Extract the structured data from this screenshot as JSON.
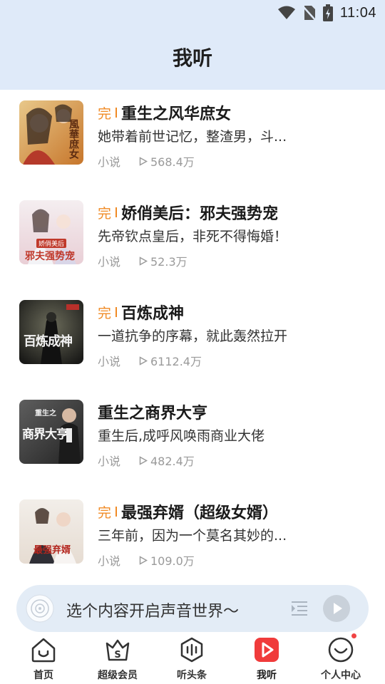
{
  "status_bar": {
    "time": "11:04"
  },
  "header": {
    "title": "我听"
  },
  "books": [
    {
      "badge": "完",
      "title": "重生之风华庶女",
      "desc": "她带着前世记忆，整渣男，斗...",
      "category": "小说",
      "plays": "568.4万"
    },
    {
      "badge": "完",
      "title": "娇俏美后：邪夫强势宠",
      "desc": "先帝钦点皇后，非死不得悔婚！",
      "category": "小说",
      "plays": "52.3万"
    },
    {
      "badge": "完",
      "title": "百炼成神",
      "desc": "一道抗争的序幕，就此轰然拉开",
      "category": "小说",
      "plays": "6112.4万"
    },
    {
      "badge": "",
      "title": "重生之商界大亨",
      "desc": "重生后,成呼风唤雨商业大佬",
      "category": "小说",
      "plays": "482.4万"
    },
    {
      "badge": "完",
      "title": "最强弃婿（超级女婿）",
      "desc": "三年前，因为一个莫名其妙的...",
      "category": "小说",
      "plays": "109.0万"
    }
  ],
  "covers": [
    {
      "text": "風華庶女"
    },
    {
      "text": "邪夫强势宠",
      "subtext": "娇俏美后"
    },
    {
      "text": "百炼成神"
    },
    {
      "text": "商界大亨",
      "subtext": "重生之"
    },
    {
      "text": "最强弃婿"
    }
  ],
  "player": {
    "prompt": "选个内容开启声音世界～"
  },
  "tabs": [
    {
      "label": "首页",
      "icon": "home-icon"
    },
    {
      "label": "超级会员",
      "icon": "vip-icon"
    },
    {
      "label": "听头条",
      "icon": "headline-icon"
    },
    {
      "label": "我听",
      "icon": "my-listen-icon"
    },
    {
      "label": "个人中心",
      "icon": "profile-icon"
    }
  ],
  "colors": {
    "header_bg": "#dfeaf9",
    "badge": "#f08a24",
    "active_tab": "#f03b3b",
    "player_bg": "#e3ecf6"
  }
}
